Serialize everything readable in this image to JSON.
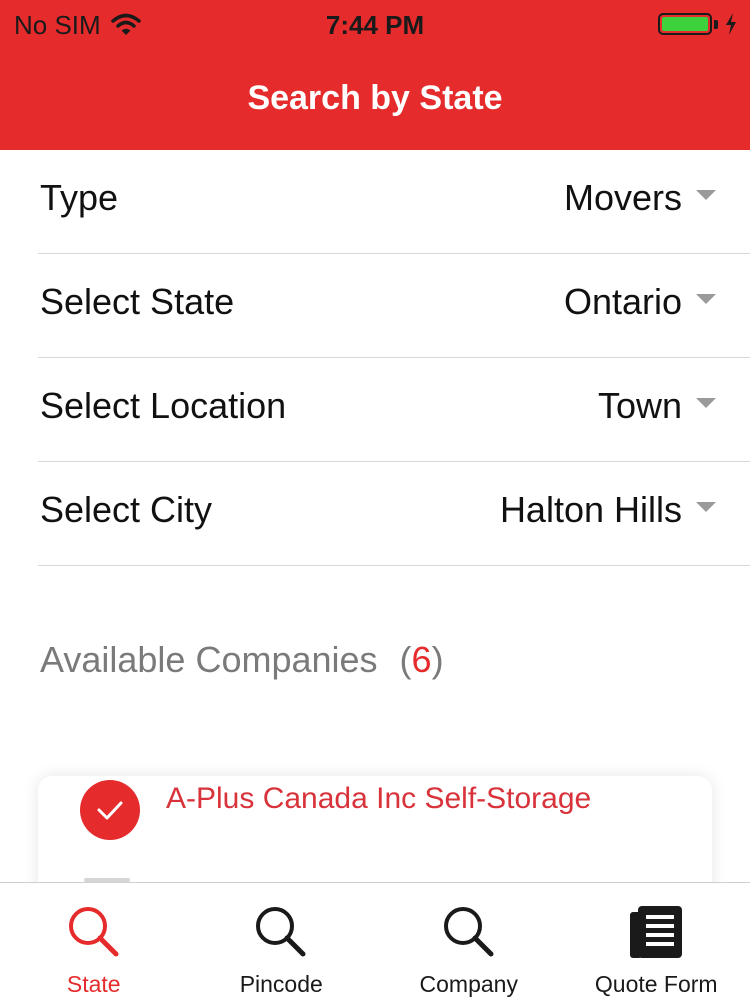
{
  "status_bar": {
    "carrier": "No SIM",
    "time": "7:44 PM",
    "battery_color": "#3ed13e"
  },
  "header": {
    "title": "Search by State",
    "background": "#e52b2b"
  },
  "form": {
    "rows": [
      {
        "label": "Type",
        "value": "Movers"
      },
      {
        "label": "Select State",
        "value": "Ontario"
      },
      {
        "label": "Select Location",
        "value": "Town"
      },
      {
        "label": "Select City",
        "value": "Halton Hills"
      }
    ]
  },
  "available": {
    "label": "Available Companies",
    "open_paren": "(",
    "count": "6",
    "close_paren": ")"
  },
  "companies": [
    {
      "name": "A-Plus Canada Inc Self-Storage",
      "selected_icon": "checkmark-icon"
    }
  ],
  "tabs": [
    {
      "label": "State",
      "icon": "search-icon",
      "active": true
    },
    {
      "label": "Pincode",
      "icon": "search-icon",
      "active": false
    },
    {
      "label": "Company",
      "icon": "search-icon",
      "active": false
    },
    {
      "label": "Quote Form",
      "icon": "document-icon",
      "active": false
    }
  ],
  "colors": {
    "accent": "#e52b2b",
    "muted_text": "#7a7a7a",
    "caret": "#9a9a9a"
  }
}
